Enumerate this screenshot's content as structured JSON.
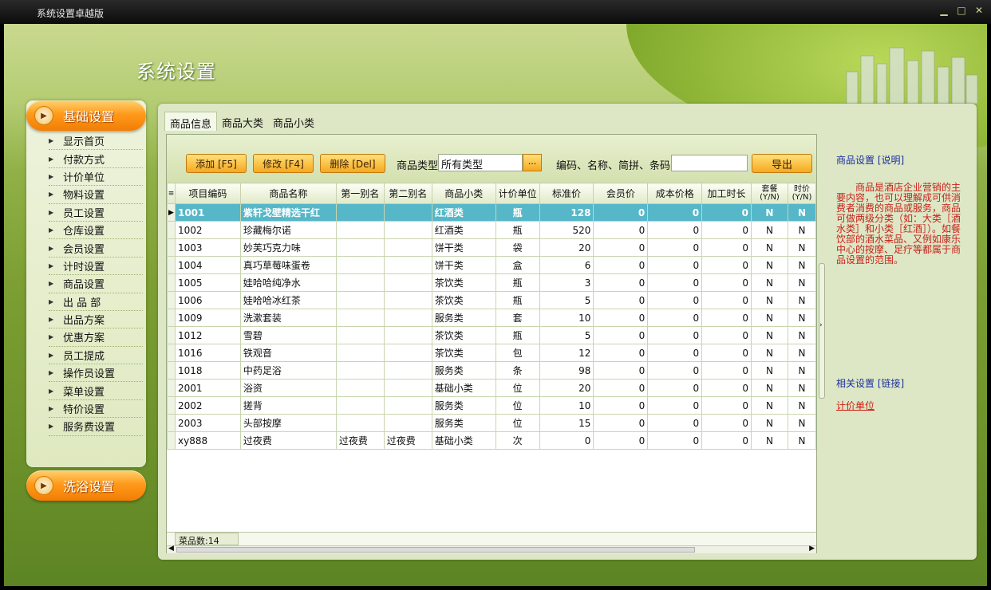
{
  "window": {
    "title": "系统设置卓越版",
    "controls": [
      "minimize-icon",
      "maximize-icon",
      "close-icon"
    ]
  },
  "page_title": "系统设置",
  "sidebar": {
    "group1": "基础设置",
    "items": [
      "显示首页",
      "付款方式",
      "计价单位",
      "物料设置",
      "员工设置",
      "仓库设置",
      "会员设置",
      "计时设置",
      "商品设置",
      "出 品 部",
      "出品方案",
      "优惠方案",
      "员工提成",
      "操作员设置",
      "菜单设置",
      "特价设置",
      "服务费设置"
    ],
    "group2": "洗浴设置"
  },
  "tabs": [
    "商品信息",
    "商品大类",
    "商品小类"
  ],
  "toolbar": {
    "add": "添加 [F5]",
    "edit": "修改 [F4]",
    "delete": "删除 [Del]",
    "type_label": "商品类型",
    "type_value": "所有类型",
    "type_btn": "...",
    "search_label": "编码、名称、简拼、条码:",
    "search_value": "",
    "export": "导出"
  },
  "grid": {
    "indicator_header": "≡",
    "columns": [
      "项目编码",
      "商品名称",
      "第一别名",
      "第二别名",
      "商品小类",
      "计价单位",
      "标准价",
      "会员价",
      "成本价格",
      "加工时长",
      "套餐",
      "时价"
    ],
    "yn": "(Y/N)",
    "rows": [
      [
        "1001",
        "紫轩戈壁精选干红",
        "",
        "",
        "红酒类",
        "瓶",
        "128",
        "0",
        "0",
        "0",
        "N",
        "N"
      ],
      [
        "1002",
        "珍藏梅尔诺",
        "",
        "",
        "红酒类",
        "瓶",
        "520",
        "0",
        "0",
        "0",
        "N",
        "N"
      ],
      [
        "1003",
        "妙芙巧克力味",
        "",
        "",
        "饼干类",
        "袋",
        "20",
        "0",
        "0",
        "0",
        "N",
        "N"
      ],
      [
        "1004",
        "真巧草莓味蛋卷",
        "",
        "",
        "饼干类",
        "盒",
        "6",
        "0",
        "0",
        "0",
        "N",
        "N"
      ],
      [
        "1005",
        "娃哈哈纯净水",
        "",
        "",
        "茶饮类",
        "瓶",
        "3",
        "0",
        "0",
        "0",
        "N",
        "N"
      ],
      [
        "1006",
        "娃哈哈冰红茶",
        "",
        "",
        "茶饮类",
        "瓶",
        "5",
        "0",
        "0",
        "0",
        "N",
        "N"
      ],
      [
        "1009",
        "洗漱套装",
        "",
        "",
        "服务类",
        "套",
        "10",
        "0",
        "0",
        "0",
        "N",
        "N"
      ],
      [
        "1012",
        "雪碧",
        "",
        "",
        "茶饮类",
        "瓶",
        "5",
        "0",
        "0",
        "0",
        "N",
        "N"
      ],
      [
        "1016",
        "铁观音",
        "",
        "",
        "茶饮类",
        "包",
        "12",
        "0",
        "0",
        "0",
        "N",
        "N"
      ],
      [
        "1018",
        "中药足浴",
        "",
        "",
        "服务类",
        "条",
        "98",
        "0",
        "0",
        "0",
        "N",
        "N"
      ],
      [
        "2001",
        "浴资",
        "",
        "",
        "基础小类",
        "位",
        "20",
        "0",
        "0",
        "0",
        "N",
        "N"
      ],
      [
        "2002",
        "搓背",
        "",
        "",
        "服务类",
        "位",
        "10",
        "0",
        "0",
        "0",
        "N",
        "N"
      ],
      [
        "2003",
        "头部按摩",
        "",
        "",
        "服务类",
        "位",
        "15",
        "0",
        "0",
        "0",
        "N",
        "N"
      ],
      [
        "xy888",
        "过夜费",
        "过夜费",
        "过夜费",
        "基础小类",
        "次",
        "0",
        "0",
        "0",
        "0",
        "N",
        "N"
      ]
    ],
    "count_label": "菜品数:14"
  },
  "info": {
    "title": "商品设置  [说明]",
    "body": "商品是酒店企业营销的主要内容，也可以理解成可供消费者消费的商品或服务，商品可做两级分类（如：大类［酒水类］和小类［红酒］）。如餐饮部的酒水菜品、又例如康乐中心的按摩、足疗等都属于商品设置的范围。",
    "related": "相关设置  [链接]",
    "related_link": "计价单位"
  },
  "colors": {
    "selected_row": "#56b7c8",
    "orange_button": "#f5a91f",
    "info_text": "#c8201a",
    "link_blue": "#1a2fa0"
  }
}
